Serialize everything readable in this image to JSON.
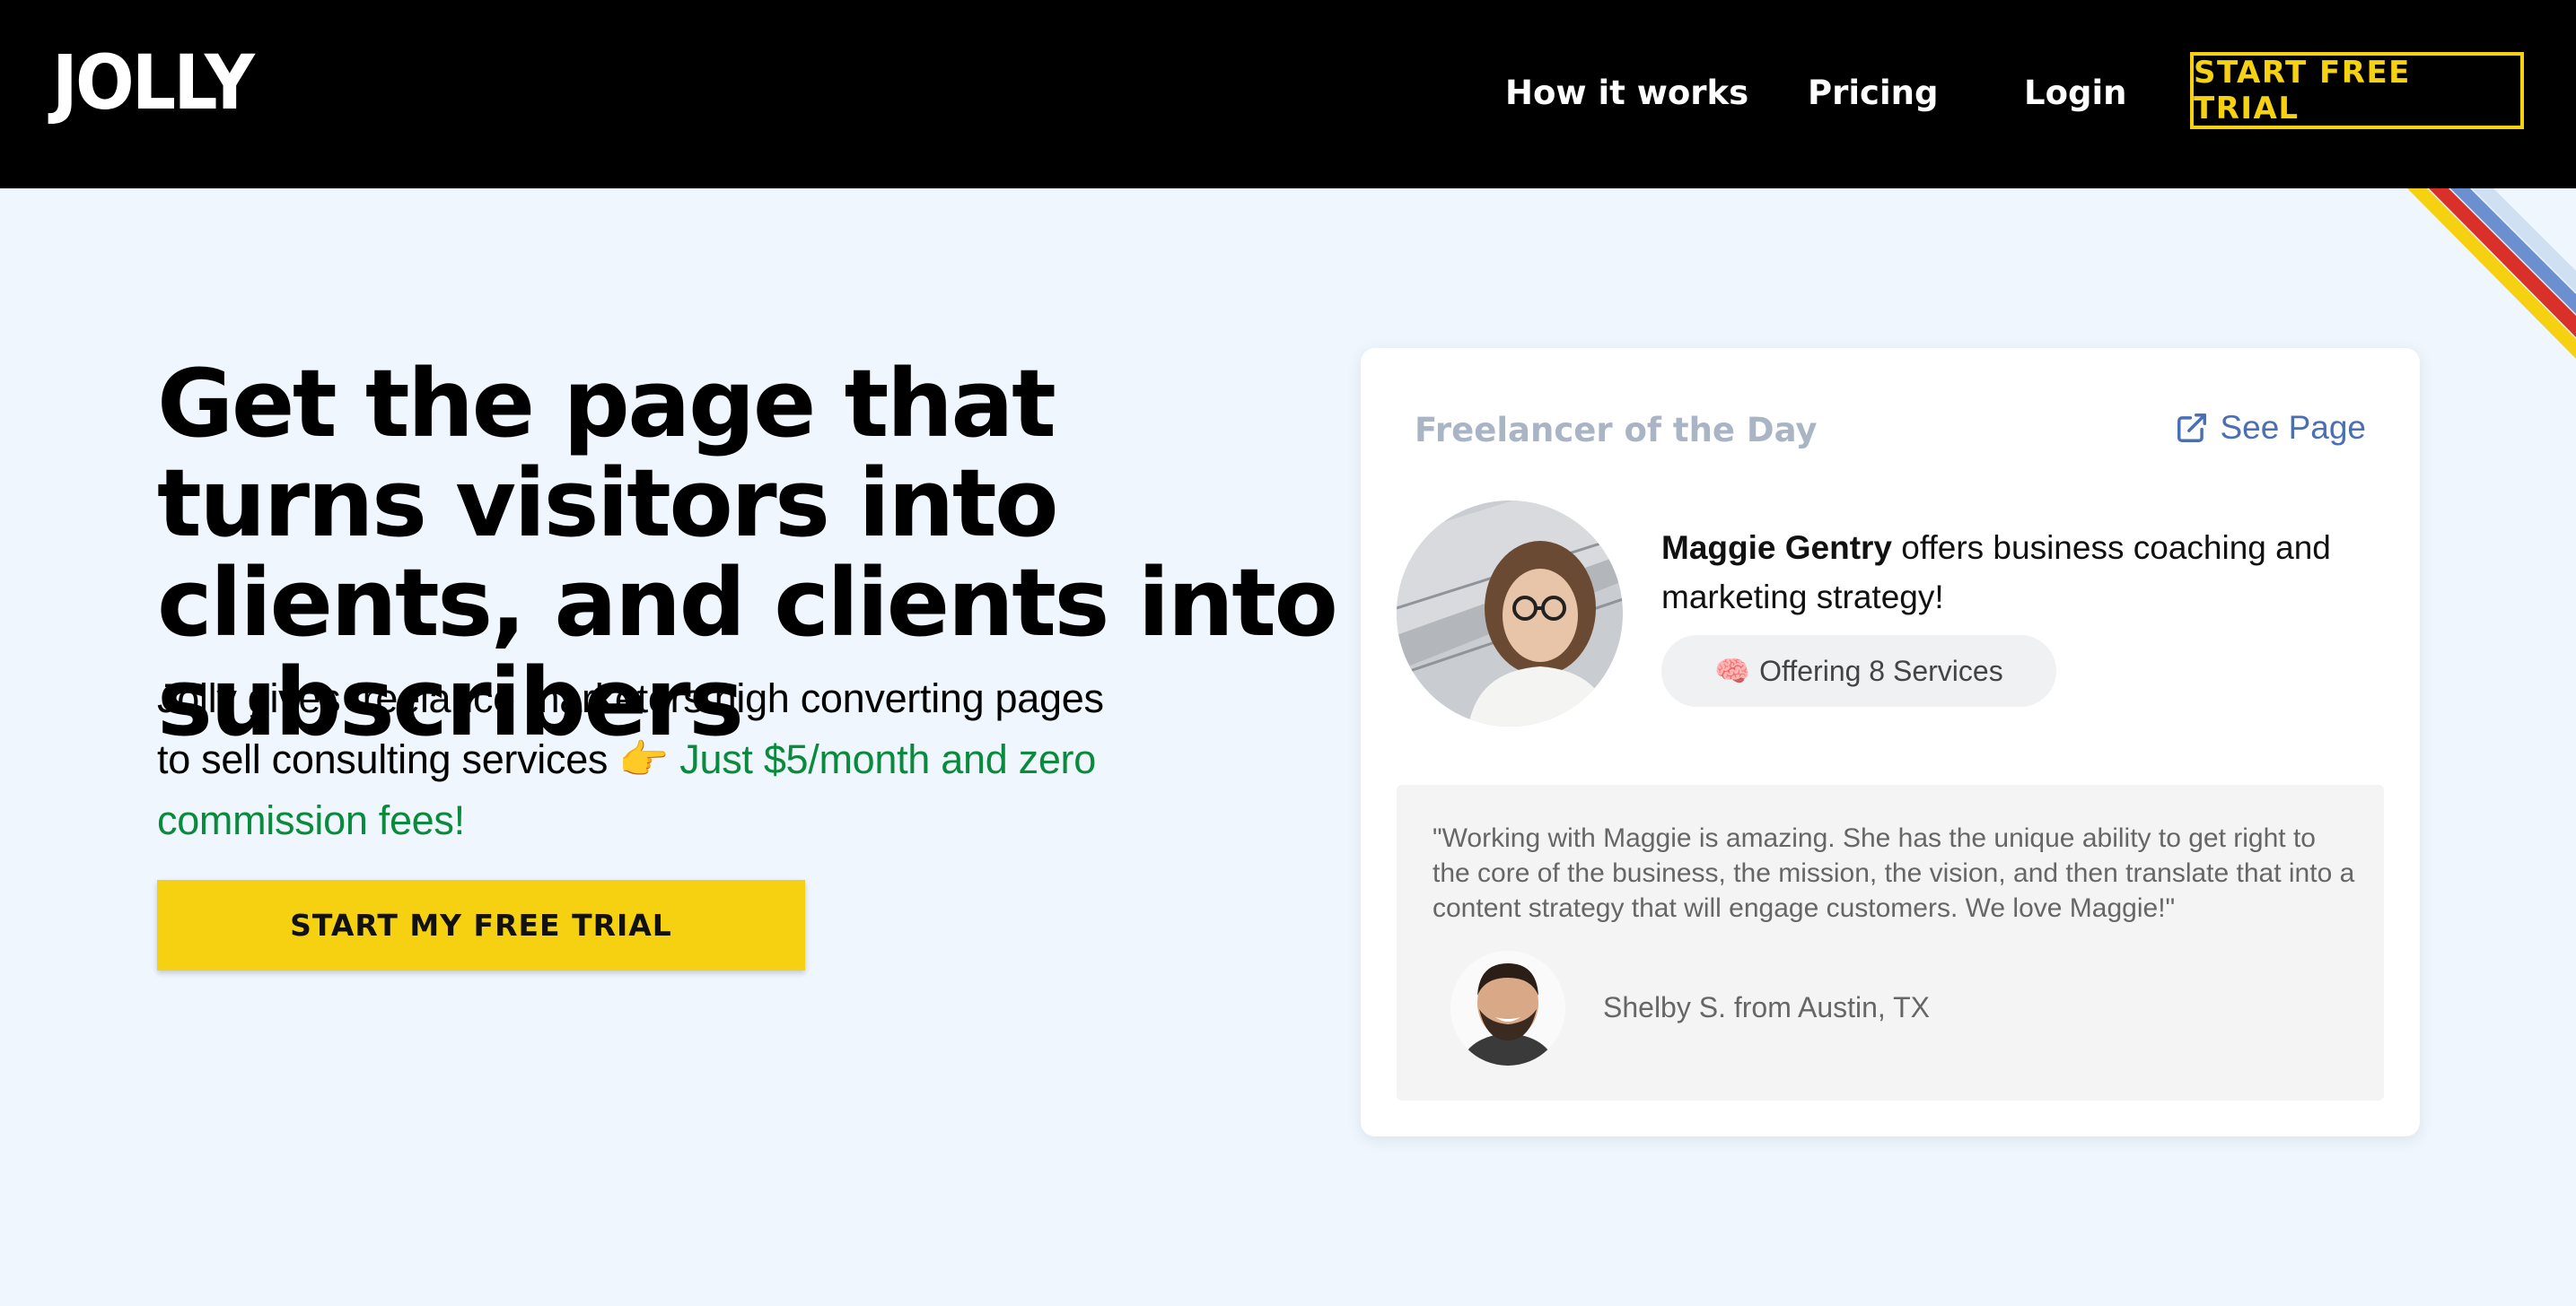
{
  "header": {
    "logo": "JOLLY",
    "nav": {
      "how_it_works": "How it works",
      "pricing": "Pricing",
      "login": "Login",
      "cta": "START FREE TRIAL"
    }
  },
  "hero": {
    "title": "Get the page that turns visitors into clients, and clients into subscribers",
    "subtitle_plain": "Jolly gives freelance marketers high converting pages to sell consulting services",
    "subtitle_emoji": "👉",
    "subtitle_highlight": "Just $5/month and zero commission fees!",
    "cta": "START MY FREE TRIAL"
  },
  "card": {
    "label": "Freelancer of the Day",
    "see_page": "See Page",
    "freelancer_name": "Maggie Gentry",
    "freelancer_offer": "offers business coaching and marketing strategy!",
    "services_emoji": "🧠",
    "services_text": "Offering 8 Services",
    "testimonial": {
      "quote": "\"Working with Maggie is amazing. She has the unique ability to get right to the core of the business, the mission, the vision, and then translate that into a content strategy that will engage customers. We love Maggie!\"",
      "author": "Shelby S. from Austin, TX"
    }
  },
  "colors": {
    "header_bg": "#000000",
    "accent_yellow": "#f6d112",
    "highlight_green": "#0a8a3c",
    "link_blue": "#4a6fb5",
    "page_bg": "#eff6fd"
  },
  "icons": [
    "external-link-icon",
    "pointing-hand-emoji",
    "brain-emoji"
  ]
}
